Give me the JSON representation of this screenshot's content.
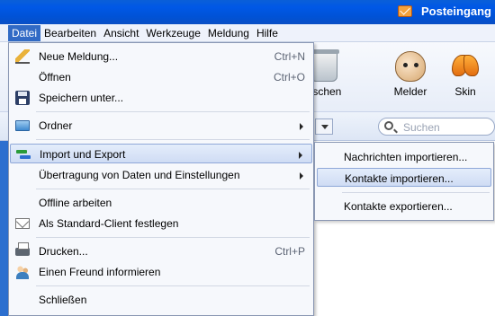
{
  "window": {
    "title": "Posteingang"
  },
  "menubar": [
    "Datei",
    "Bearbeiten",
    "Ansicht",
    "Werkzeuge",
    "Meldung",
    "Hilfe"
  ],
  "menubar_active": "Datei",
  "toolbar": {
    "delete_label": "Löschen",
    "delete_visible_label": "öschen",
    "melder_label": "Melder",
    "skin_label": "Skin"
  },
  "search": {
    "placeholder": "Suchen"
  },
  "file_menu": {
    "new_message": {
      "label": "Neue Meldung...",
      "shortcut": "Ctrl+N"
    },
    "open": {
      "label": "Öffnen",
      "shortcut": "Ctrl+O"
    },
    "save_as": {
      "label": "Speichern unter..."
    },
    "folder": {
      "label": "Ordner"
    },
    "import_export": {
      "label": "Import und Export"
    },
    "transfer": {
      "label": "Übertragung von Daten und Einstellungen"
    },
    "offline": {
      "label": "Offline arbeiten"
    },
    "default_client": {
      "label": "Als Standard-Client festlegen"
    },
    "print": {
      "label": "Drucken...",
      "shortcut": "Ctrl+P"
    },
    "inform_friend": {
      "label": "Einen Freund informieren"
    },
    "close": {
      "label": "Schließen"
    }
  },
  "import_export_submenu": {
    "import_messages": "Nachrichten importieren...",
    "import_contacts": "Kontakte importieren...",
    "export_contacts": "Kontakte exportieren..."
  },
  "highlight_color": "#316ac5"
}
